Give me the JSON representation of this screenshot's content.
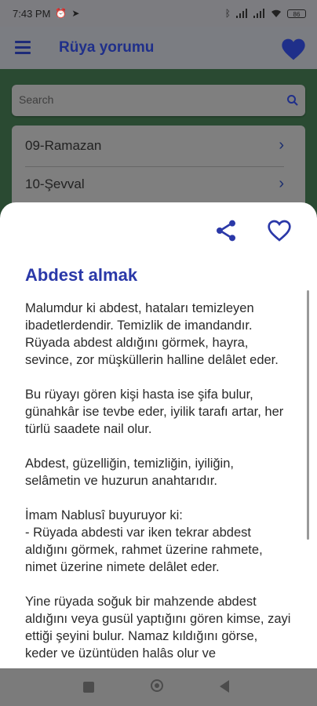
{
  "status_bar": {
    "time": "7:43 PM",
    "left_icons": [
      "alarm-icon",
      "telegram-icon"
    ],
    "right_icons": [
      "bluetooth-icon",
      "signal-icon",
      "signal-icon",
      "wifi-icon"
    ],
    "battery": "86"
  },
  "app_bar": {
    "title": "Rüya yorumu"
  },
  "search": {
    "placeholder": "Search"
  },
  "list": {
    "items": [
      {
        "label": "09-Ramazan"
      },
      {
        "label": "10-Şevval"
      }
    ]
  },
  "sheet": {
    "title": "Abdest almak",
    "paragraphs": [
      "Malumdur ki abdest, hataları temizleyen ibadetlerdendir. Temizlik de imandandır. Rüyada abdest aldığını görmek, hayra, sevince, zor müşküllerin halline delâlet eder.",
      "Bu rüyayı gören kişi hasta ise şifa bulur, günahkâr ise tevbe eder, iyilik tarafı artar, her türlü saadete nail olur.",
      "Abdest, güzelliğin, temizliğin, iyiliğin, selâmetin ve huzurun anahtarıdır.",
      "İmam Nablusî buyuruyor ki:\n- Rüyada abdesti var iken tekrar abdest aldığını görmek, rahmet üzerine rahmete, nimet üzerine nimete delâlet eder.",
      "Yine rüyada soğuk bir mahzende abdest aldığını veya gusül yaptığını gören kimse, zayi ettiği şeyini bulur. Namaz kıldığını görse, keder ve üzüntüden halâs olur ve"
    ]
  },
  "colors": {
    "accent": "#2a38a8",
    "header_title": "#1f2f8a",
    "overlay": "#7b7d82"
  }
}
